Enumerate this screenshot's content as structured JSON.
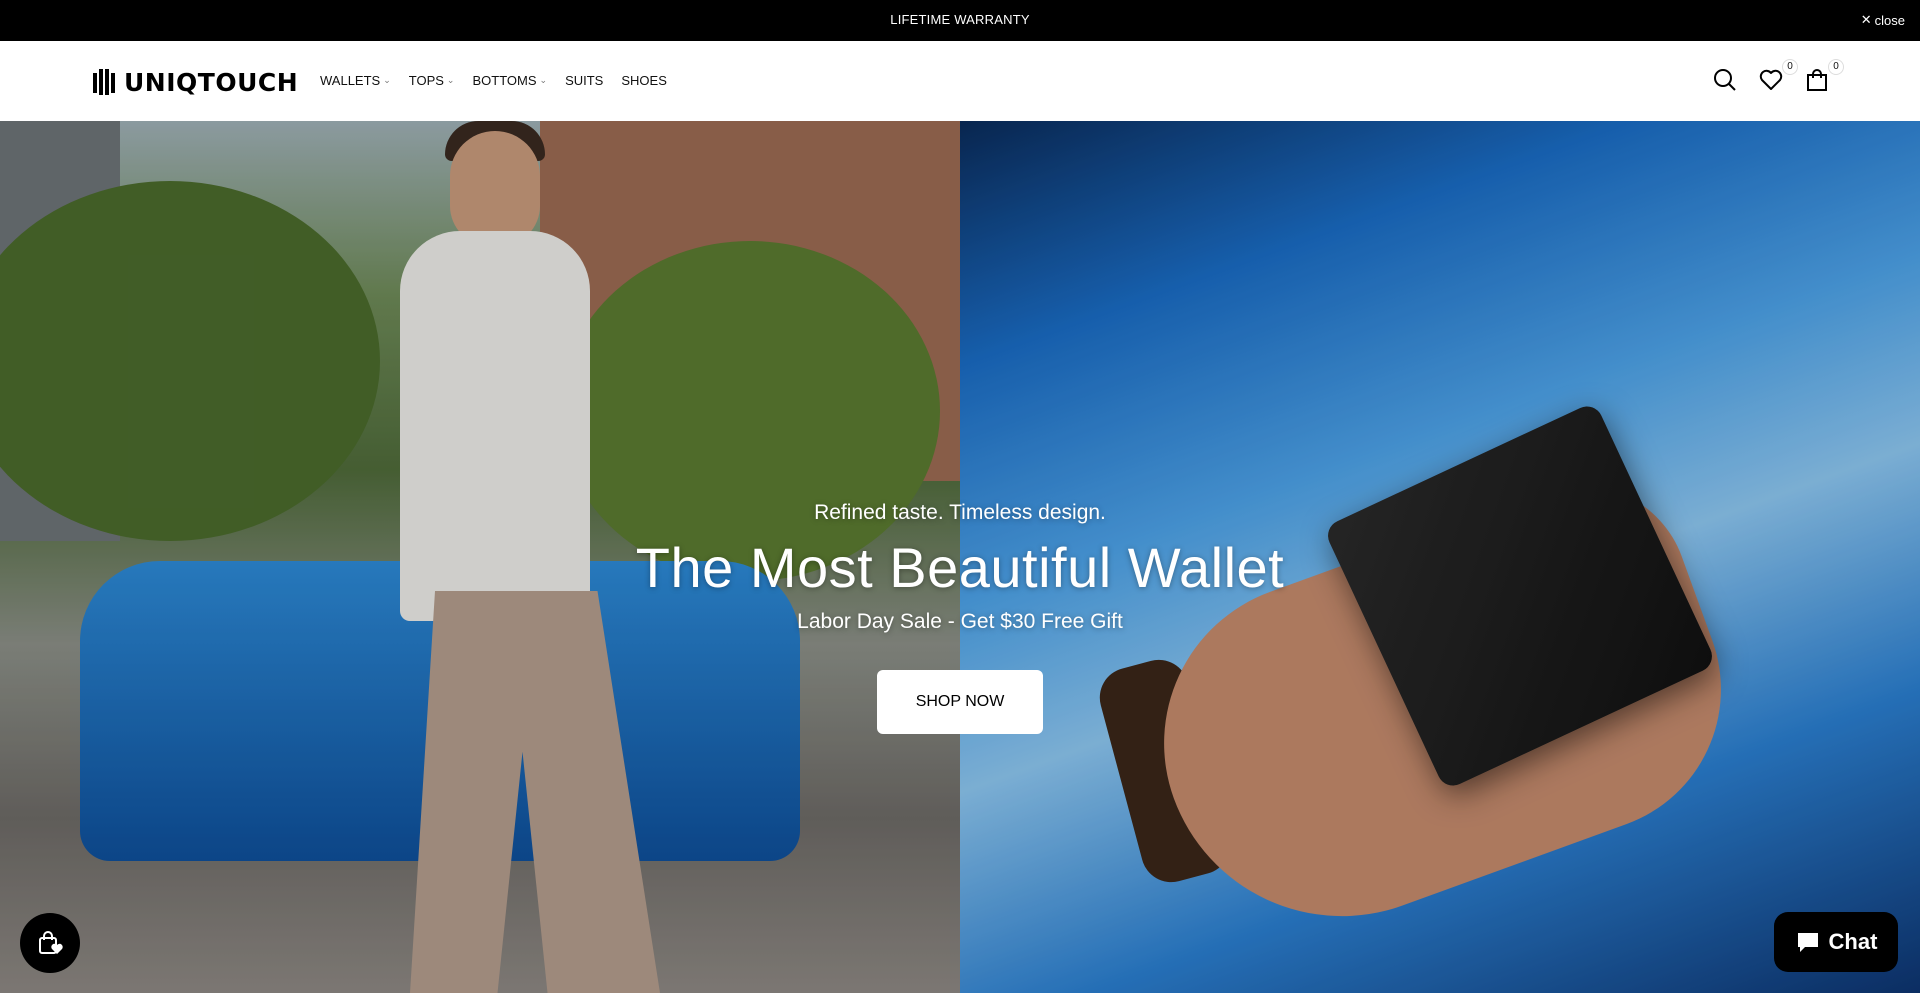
{
  "announcement": {
    "text": "LIFETIME WARRANTY",
    "close_label": "close"
  },
  "header": {
    "logo_text": "UNIQTOUCH",
    "nav": [
      {
        "label": "WALLETS",
        "has_dropdown": true
      },
      {
        "label": "TOPS",
        "has_dropdown": true
      },
      {
        "label": "BOTTOMS",
        "has_dropdown": true
      },
      {
        "label": "SUITS",
        "has_dropdown": false
      },
      {
        "label": "SHOES",
        "has_dropdown": false
      }
    ],
    "wishlist_count": "0",
    "cart_count": "0"
  },
  "hero": {
    "subtitle": "Refined taste. Timeless design.",
    "title": "The Most Beautiful Wallet",
    "offer": "Labor Day Sale - Get $30 Free Gift",
    "cta_label": "SHOP NOW"
  },
  "chat": {
    "label": "Chat"
  },
  "colors": {
    "announce_bg": "#000000",
    "header_bg": "#ffffff",
    "cta_bg": "#ffffff",
    "chat_bg": "#000000"
  }
}
